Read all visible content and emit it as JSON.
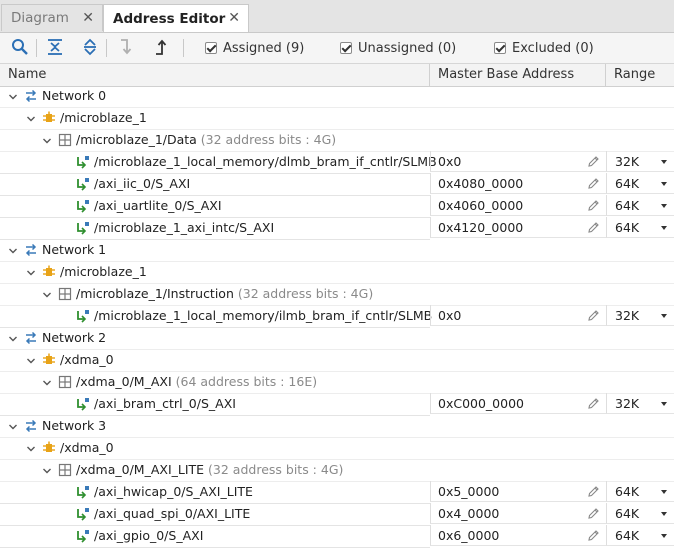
{
  "tabs": [
    {
      "label": "Diagram",
      "active": false
    },
    {
      "label": "Address Editor",
      "active": true
    }
  ],
  "toolbar": {
    "assigned_label": "Assigned (9)",
    "unassigned_label": "Unassigned (0)",
    "excluded_label": "Excluded (0)"
  },
  "columns": {
    "name": "Name",
    "address": "Master Base Address",
    "range": "Range"
  },
  "rows": [
    {
      "type": "network",
      "text": "Network 0"
    },
    {
      "type": "master",
      "text": "/microblaze_1"
    },
    {
      "type": "space",
      "text": "/microblaze_1/Data",
      "info": "(32 address bits : 4G)"
    },
    {
      "type": "seg",
      "text": "/microblaze_1_local_memory/dlmb_bram_if_cntlr/SLMB",
      "address": "0x0",
      "range": "32K"
    },
    {
      "type": "seg",
      "text": "/axi_iic_0/S_AXI",
      "address": "0x4080_0000",
      "range": "64K"
    },
    {
      "type": "seg",
      "text": "/axi_uartlite_0/S_AXI",
      "address": "0x4060_0000",
      "range": "64K"
    },
    {
      "type": "seg",
      "text": "/microblaze_1_axi_intc/S_AXI",
      "address": "0x4120_0000",
      "range": "64K"
    },
    {
      "type": "network",
      "text": "Network 1"
    },
    {
      "type": "master",
      "text": "/microblaze_1"
    },
    {
      "type": "space",
      "text": "/microblaze_1/Instruction",
      "info": "(32 address bits : 4G)"
    },
    {
      "type": "seg",
      "text": "/microblaze_1_local_memory/ilmb_bram_if_cntlr/SLMB",
      "address": "0x0",
      "range": "32K"
    },
    {
      "type": "network",
      "text": "Network 2"
    },
    {
      "type": "master",
      "text": "/xdma_0"
    },
    {
      "type": "space",
      "text": "/xdma_0/M_AXI",
      "info": "(64 address bits : 16E)"
    },
    {
      "type": "seg",
      "text": "/axi_bram_ctrl_0/S_AXI",
      "address": "0xC000_0000",
      "range": "32K"
    },
    {
      "type": "network",
      "text": "Network 3"
    },
    {
      "type": "master",
      "text": "/xdma_0"
    },
    {
      "type": "space",
      "text": "/xdma_0/M_AXI_LITE",
      "info": "(32 address bits : 4G)"
    },
    {
      "type": "seg",
      "text": "/axi_hwicap_0/S_AXI_LITE",
      "address": "0x5_0000",
      "range": "64K"
    },
    {
      "type": "seg",
      "text": "/axi_quad_spi_0/AXI_LITE",
      "address": "0x4_0000",
      "range": "64K"
    },
    {
      "type": "seg",
      "text": "/axi_gpio_0/S_AXI",
      "address": "0x6_0000",
      "range": "64K"
    }
  ]
}
